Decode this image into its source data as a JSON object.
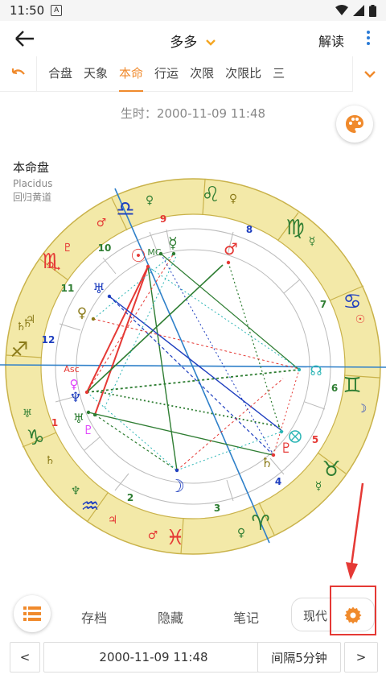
{
  "status": {
    "time": "11:50",
    "sim_letter": "A"
  },
  "appbar": {
    "title": "多多",
    "explain_label": "解读"
  },
  "tabs": [
    "合盘",
    "天象",
    "本命",
    "行运",
    "次限",
    "次限比",
    "三"
  ],
  "active_tab": "本命",
  "birth_line": "生时：2000-11-09 11:48",
  "chart_label": {
    "name": "本命盘",
    "system": "Placidus",
    "zodiac": "回归黄道"
  },
  "houses": [
    "1",
    "2",
    "3",
    "4",
    "5",
    "6",
    "7",
    "8",
    "9",
    "10",
    "11",
    "12"
  ],
  "chart_markers": {
    "asc": "Asc",
    "mc": "MC"
  },
  "sign_glyphs": {
    "leo": "♌",
    "virgo": "♍",
    "cancer": "♋",
    "gemini": "♊",
    "taurus": "♉",
    "aries": "♈",
    "pisces": "♓",
    "aquarius": "♒",
    "capricorn": "♑",
    "sagittarius": "♐",
    "scorpio": "♏",
    "libra": "♎"
  },
  "planet_glyphs": {
    "sun": "☉",
    "moon": "☽",
    "mercury": "☿",
    "venus": "♀",
    "mars": "♂",
    "jupiter": "♃",
    "saturn": "♄",
    "uranus": "♅",
    "neptune": "♆",
    "pluto": "♇",
    "node": "☊"
  },
  "actions": {
    "archive": "存档",
    "hide": "隐藏",
    "notes": "笔记",
    "style": "现代"
  },
  "nav": {
    "prev": "<",
    "date": "2000-11-09 11:48",
    "interval": "间隔5分钟",
    "next": ">"
  },
  "colors": {
    "accent": "#f08a2c",
    "highlight": "#e53935",
    "zodiac_ring": "#f3e9a8",
    "ring_stroke": "#c9b24a"
  }
}
